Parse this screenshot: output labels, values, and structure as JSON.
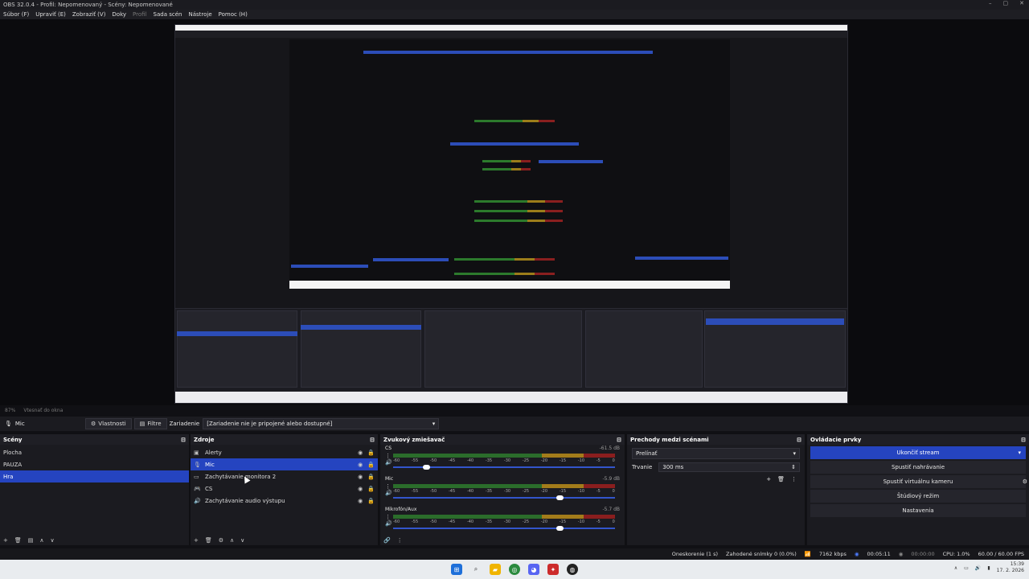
{
  "window": {
    "title": "OBS 32.0.4 - Profil: Nepomenovaný - Scény: Nepomenované",
    "controls": [
      "–",
      "▢",
      "✕"
    ]
  },
  "menu": [
    {
      "label": "Súbor (F)",
      "enabled": true
    },
    {
      "label": "Upraviť (E)",
      "enabled": true
    },
    {
      "label": "Zobraziť (V)",
      "enabled": true
    },
    {
      "label": "Doky",
      "enabled": true
    },
    {
      "label": "Profil",
      "enabled": false
    },
    {
      "label": "Sada scén",
      "enabled": true
    },
    {
      "label": "Nástroje",
      "enabled": true
    },
    {
      "label": "Pomoc (H)",
      "enabled": true
    }
  ],
  "zoom": {
    "value": "87%",
    "mode": "Vtesnať do okna"
  },
  "toolbar": {
    "source_name": "Mic",
    "properties_label": "Vlastnosti",
    "filters_label": "Filtre",
    "device_label": "Zariadenie",
    "device_value": "[Zariadenie nie je pripojené alebo dostupné]"
  },
  "scenes": {
    "title": "Scény",
    "items": [
      {
        "label": "Plocha",
        "selected": false
      },
      {
        "label": "PAUZA",
        "selected": false
      },
      {
        "label": "Hra",
        "selected": true
      }
    ]
  },
  "sources": {
    "title": "Zdroje",
    "items": [
      {
        "label": "Alerty",
        "icon": "▣",
        "selected": false
      },
      {
        "label": "Mic",
        "icon": "🎙",
        "selected": true
      },
      {
        "label": "Zachytávanie monitora 2",
        "icon": "▭",
        "selected": false
      },
      {
        "label": "CS",
        "icon": "🎮",
        "selected": false
      },
      {
        "label": "Zachytávanie audio výstupu",
        "icon": "🔊",
        "selected": false
      }
    ]
  },
  "mixer": {
    "title": "Zvukový zmiešavač",
    "ticks": [
      "-60",
      "-55",
      "-50",
      "-45",
      "-40",
      "-35",
      "-30",
      "-25",
      "-20",
      "-15",
      "-10",
      "-5",
      "0"
    ],
    "channels": [
      {
        "name": "CS",
        "db": "-61.5 dB",
        "volume_pct": 15
      },
      {
        "name": "Mic",
        "db": "-5.9 dB",
        "volume_pct": 75
      },
      {
        "name": "Mikrofón/Aux",
        "db": "-5.7 dB",
        "volume_pct": 75
      }
    ]
  },
  "transitions": {
    "title": "Prechody medzi scénami",
    "selected": "Prelínať",
    "duration_label": "Trvanie",
    "duration_value": "300 ms"
  },
  "controls": {
    "title": "Ovládacie prvky",
    "stop_stream": "Ukončiť stream",
    "start_recording": "Spustiť nahrávanie",
    "start_virtualcam": "Spustiť virtuálnu kameru",
    "studio_mode": "Štúdiový režim",
    "settings": "Nastavenia"
  },
  "status": {
    "dropped": "Oneskorenie (1 s)",
    "skipped_frames": "Zahodené snímky 0 (0.0%)",
    "bitrate": "7162 kbps",
    "stream_time": "00:05:11",
    "rec_time": "00:00:00",
    "cpu": "CPU: 1.0%",
    "fps": "60.00 / 60.00 FPS"
  },
  "clock": {
    "time": "15:39",
    "date": "17. 2. 2026"
  },
  "colors": {
    "accent": "#2544c0",
    "panel": "#1b1b20",
    "background": "#101014"
  }
}
